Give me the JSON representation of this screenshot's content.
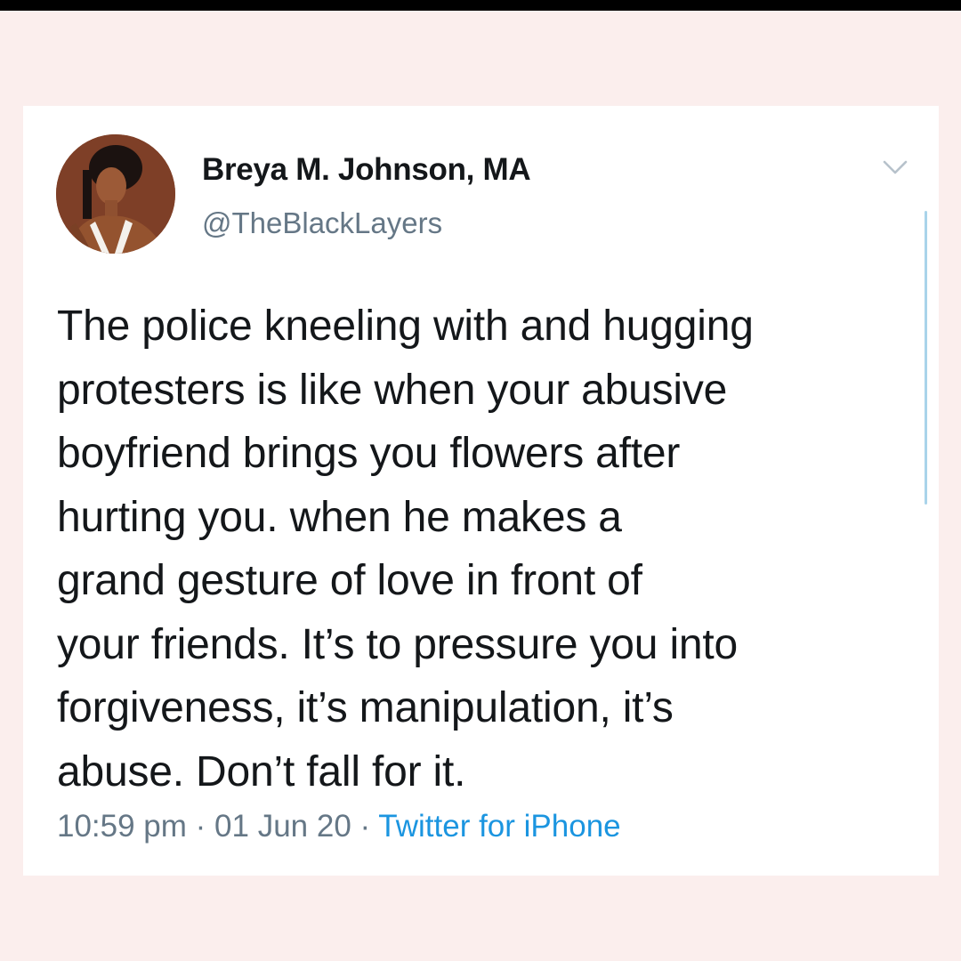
{
  "tweet": {
    "display_name": "Breya M. Johnson, MA",
    "handle": "@TheBlackLayers",
    "text": "The police kneeling with and hugging\nprotesters is like when your abusive\nboyfriend brings you flowers after\nhurting you.  when he makes a\ngrand gesture of love in front of\nyour friends. It’s to pressure you into\nforgiveness, it’s manipulation, it’s\nabuse. Don’t fall for it.",
    "time": "10:59 pm",
    "separator": " · ",
    "date": "01 Jun 20",
    "source": "Twitter for iPhone"
  },
  "icons": {
    "menu": "chevron-down-icon",
    "avatar": "profile-photo"
  },
  "colors": {
    "background": "#fbeeed",
    "card": "#ffffff",
    "text": "#14171a",
    "secondary": "#657786",
    "link": "#1b95e0"
  }
}
